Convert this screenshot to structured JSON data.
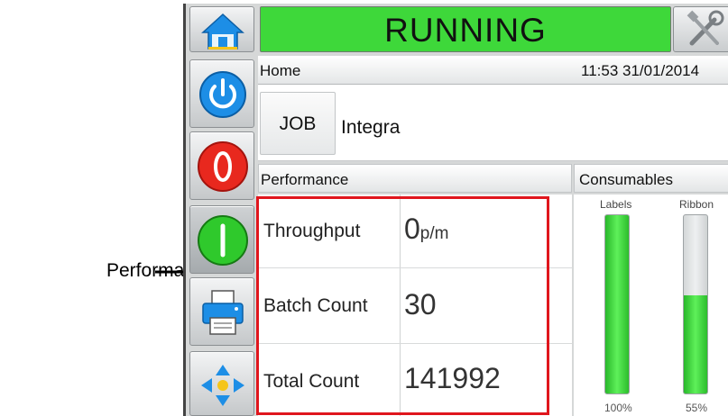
{
  "callout": {
    "label": "Performance"
  },
  "status": {
    "text": "RUNNING",
    "color": "#3ed83a"
  },
  "header": {
    "breadcrumb": "Home",
    "time": "11:53 31/01/2014"
  },
  "job": {
    "button_label": "JOB",
    "name": "Integra"
  },
  "performance": {
    "title": "Performance",
    "rows": [
      {
        "label": "Throughput",
        "value": "0",
        "unit": "p/m"
      },
      {
        "label": "Batch Count",
        "value": "30",
        "unit": ""
      },
      {
        "label": "Total Count",
        "value": "141992",
        "unit": ""
      }
    ]
  },
  "consumables": {
    "title": "Consumables",
    "items": [
      {
        "label": "Labels",
        "percent_text": "100%",
        "level": 1.0
      },
      {
        "label": "Ribbon",
        "percent_text": "55%",
        "level": 0.55
      }
    ]
  },
  "side_buttons": [
    {
      "name": "home-button",
      "icon": "home-icon"
    },
    {
      "name": "power-button",
      "icon": "power-icon"
    },
    {
      "name": "stop-button",
      "icon": "stop-icon"
    },
    {
      "name": "start-button",
      "icon": "start-icon"
    },
    {
      "name": "print-button",
      "icon": "printer-icon"
    },
    {
      "name": "navigate-button",
      "icon": "move-arrows-icon"
    }
  ],
  "colors": {
    "highlight": "#e0161d",
    "accent_blue": "#1d8ee6",
    "stop_red": "#e8281e",
    "start_green": "#2fc92c"
  }
}
